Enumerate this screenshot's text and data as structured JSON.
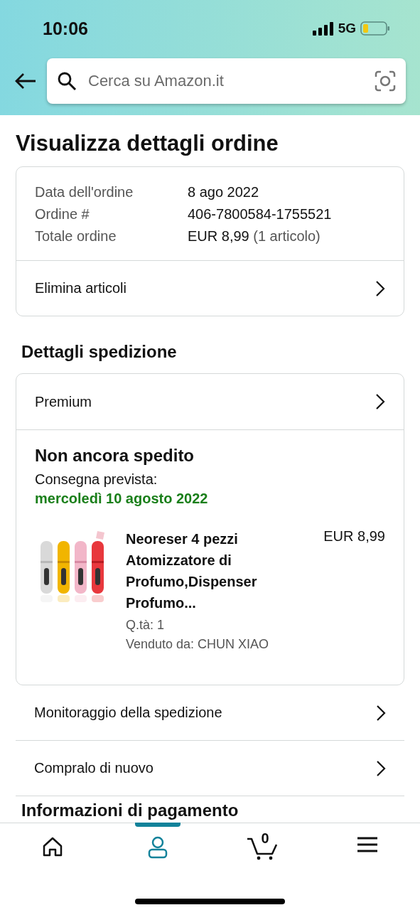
{
  "status_bar": {
    "time": "10:06",
    "network": "5G"
  },
  "search": {
    "placeholder": "Cerca su Amazon.it"
  },
  "title": "Visualizza dettagli ordine",
  "order_summary": {
    "rows": [
      {
        "label": "Data dell'ordine",
        "value": "8 ago 2022"
      },
      {
        "label": "Ordine #",
        "value": "406-7800584-1755521"
      },
      {
        "label": "Totale ordine",
        "value": "EUR 8,99",
        "note": "(1 articolo)"
      }
    ],
    "action": "Elimina articoli"
  },
  "shipping": {
    "heading": "Dettagli spedizione",
    "option": "Premium",
    "status": "Non ancora spedito",
    "delivery_label": "Consegna prevista:",
    "delivery_date": "mercoledì 10 agosto 2022",
    "item": {
      "name": "Neoreser 4 pezzi Atomizzatore di Profumo,Dispenser Profumo...",
      "price": "EUR 8,99",
      "quantity": "Q.tà: 1",
      "seller": "Venduto da: CHUN XIAO"
    }
  },
  "actions": [
    "Monitoraggio della spedizione",
    "Compralo di nuovo"
  ],
  "next_heading": "Informazioni di pagamento",
  "nav": [
    {
      "kind": "home",
      "selected": false
    },
    {
      "kind": "account",
      "selected": true
    },
    {
      "kind": "cart",
      "selected": false,
      "count": "0"
    },
    {
      "kind": "menu",
      "selected": false
    }
  ]
}
